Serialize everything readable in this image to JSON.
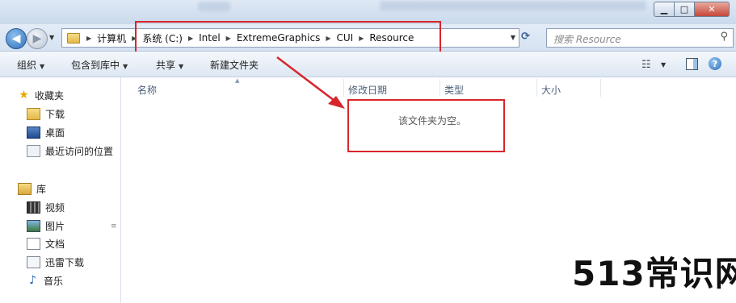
{
  "window": {
    "controls": {
      "minimize": "▁",
      "maximize": "□",
      "close": "✕"
    }
  },
  "address": {
    "crumbs": [
      "计算机",
      "系统 (C:)",
      "Intel",
      "ExtremeGraphics",
      "CUI",
      "Resource"
    ],
    "search_placeholder": "搜索 Resource"
  },
  "toolbar": {
    "organize": "组织",
    "include_in_library": "包含到库中",
    "share": "共享",
    "new_folder": "新建文件夹"
  },
  "sidebar": {
    "favorites": {
      "label": "收藏夹",
      "items": [
        "下载",
        "桌面",
        "最近访问的位置"
      ]
    },
    "libraries": {
      "label": "库",
      "items": [
        "视频",
        "图片",
        "文档",
        "迅雷下载",
        "音乐"
      ]
    }
  },
  "columns": [
    "名称",
    "修改日期",
    "类型",
    "大小"
  ],
  "content": {
    "empty_message": "该文件夹为空。"
  },
  "watermark": "513常识网",
  "colors": {
    "annotation": "#d8252b",
    "accent": "#2f6fb8"
  }
}
